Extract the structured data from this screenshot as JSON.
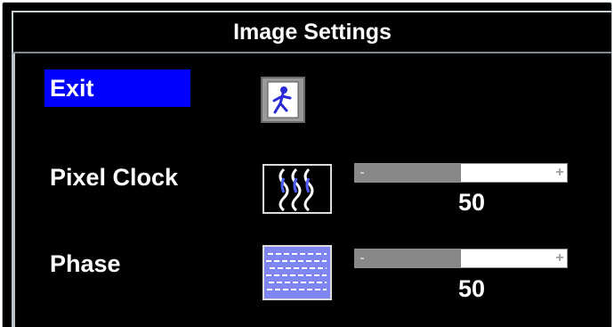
{
  "title": "Image Settings",
  "menu": {
    "exit_label": "Exit",
    "pixel_clock_label": "Pixel Clock",
    "phase_label": "Phase"
  },
  "controls": {
    "pixel_clock": {
      "value": "50",
      "level": 0.5
    },
    "phase": {
      "value": "50",
      "level": 0.5
    }
  },
  "icons": {
    "exit": "exit-icon",
    "pixel_clock": "pixel-clock-icon",
    "phase": "phase-icon"
  },
  "colors": {
    "background": "#000000",
    "selection": "#0000ff",
    "text": "#ffffff",
    "slider_track": "#ffffff",
    "slider_fill": "#888888",
    "frame": "#b9c4c8"
  }
}
